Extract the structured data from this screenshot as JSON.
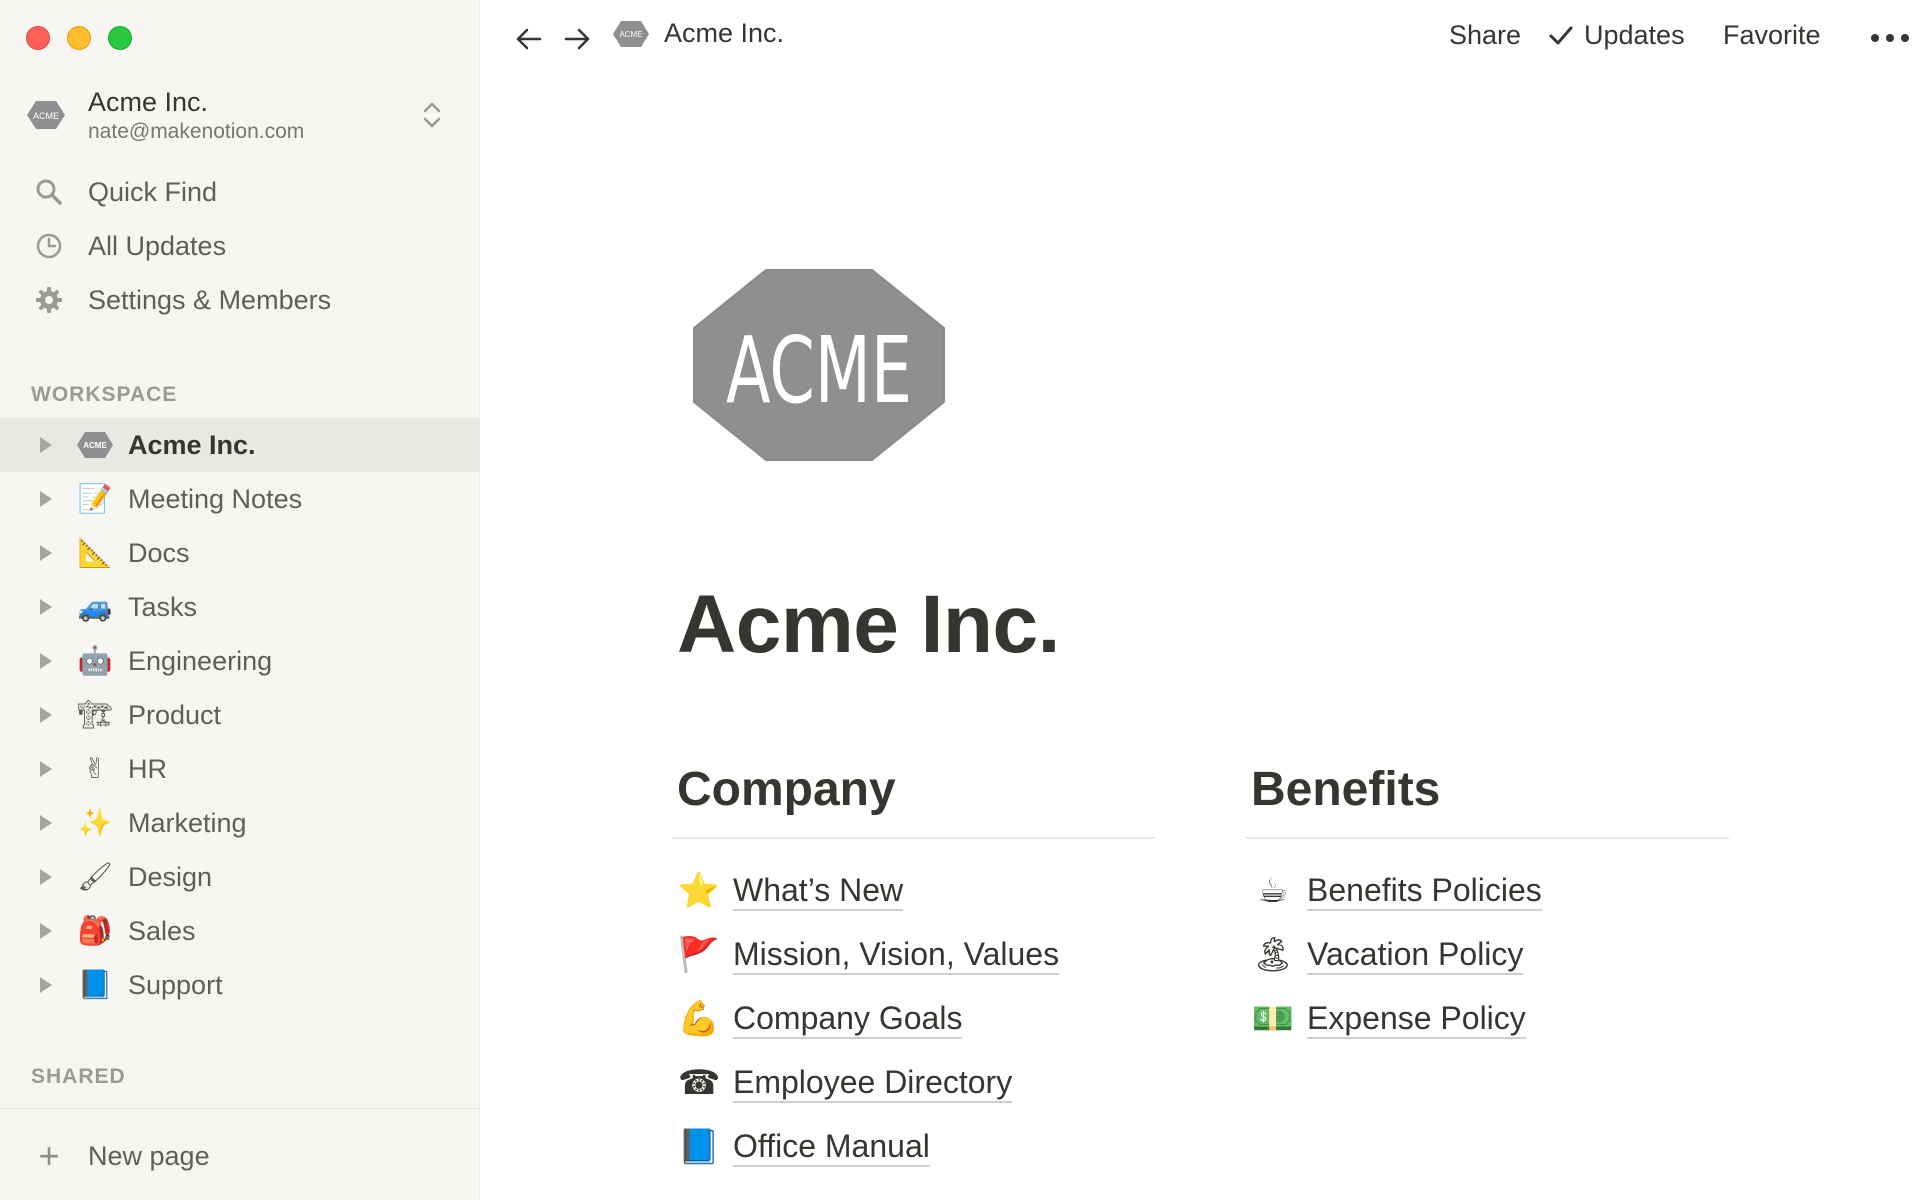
{
  "window": {
    "controls": {
      "close": "#ff5f57",
      "minimize": "#febc2e",
      "zoom": "#28c840"
    }
  },
  "sidebar": {
    "workspace_name": "Acme Inc.",
    "workspace_email": "nate@makenotion.com",
    "logo_text": "ACME",
    "quick_links": [
      {
        "label": "Quick Find",
        "icon": "search-icon"
      },
      {
        "label": "All Updates",
        "icon": "clock-icon"
      },
      {
        "label": "Settings & Members",
        "icon": "gear-icon"
      }
    ],
    "workspace_label": "WORKSPACE",
    "pages": [
      {
        "label": "Acme Inc.",
        "emoji": "acme-logo",
        "active": true
      },
      {
        "label": "Meeting Notes",
        "emoji": "📝"
      },
      {
        "label": "Docs",
        "emoji": "📐"
      },
      {
        "label": "Tasks",
        "emoji": "🚙"
      },
      {
        "label": "Engineering",
        "emoji": "🤖"
      },
      {
        "label": "Product",
        "emoji": "🏗"
      },
      {
        "label": "HR",
        "emoji": "✌"
      },
      {
        "label": "Marketing",
        "emoji": "✨"
      },
      {
        "label": "Design",
        "emoji": "🖌"
      },
      {
        "label": "Sales",
        "emoji": "🎒"
      },
      {
        "label": "Support",
        "emoji": "📘"
      }
    ],
    "shared_label": "SHARED",
    "new_page_label": "New page"
  },
  "topbar": {
    "breadcrumb": "Acme Inc.",
    "share_label": "Share",
    "updates_label": "Updates",
    "favorite_label": "Favorite"
  },
  "main": {
    "icon_text": "ACME",
    "title": "Acme Inc.",
    "company": {
      "heading": "Company",
      "links": [
        {
          "emoji": "⭐",
          "label": "What’s New"
        },
        {
          "emoji": "🚩",
          "label": "Mission, Vision, Values"
        },
        {
          "emoji": "💪",
          "label": "Company Goals"
        },
        {
          "emoji": "☎",
          "label": "Employee Directory"
        },
        {
          "emoji": "📘",
          "label": "Office Manual"
        }
      ]
    },
    "benefits": {
      "heading": "Benefits",
      "links": [
        {
          "emoji": "☕",
          "label": "Benefits Policies"
        },
        {
          "emoji": "🏝",
          "label": "Vacation Policy"
        },
        {
          "emoji": "💵",
          "label": "Expense Policy"
        }
      ]
    }
  },
  "colors": {
    "sidebar_bg": "#f7f6f3",
    "active_item_bg": "#e9e8e5",
    "text": "#37352f",
    "muted_text": "#787774",
    "logo_gray": "#8f8f8f"
  }
}
